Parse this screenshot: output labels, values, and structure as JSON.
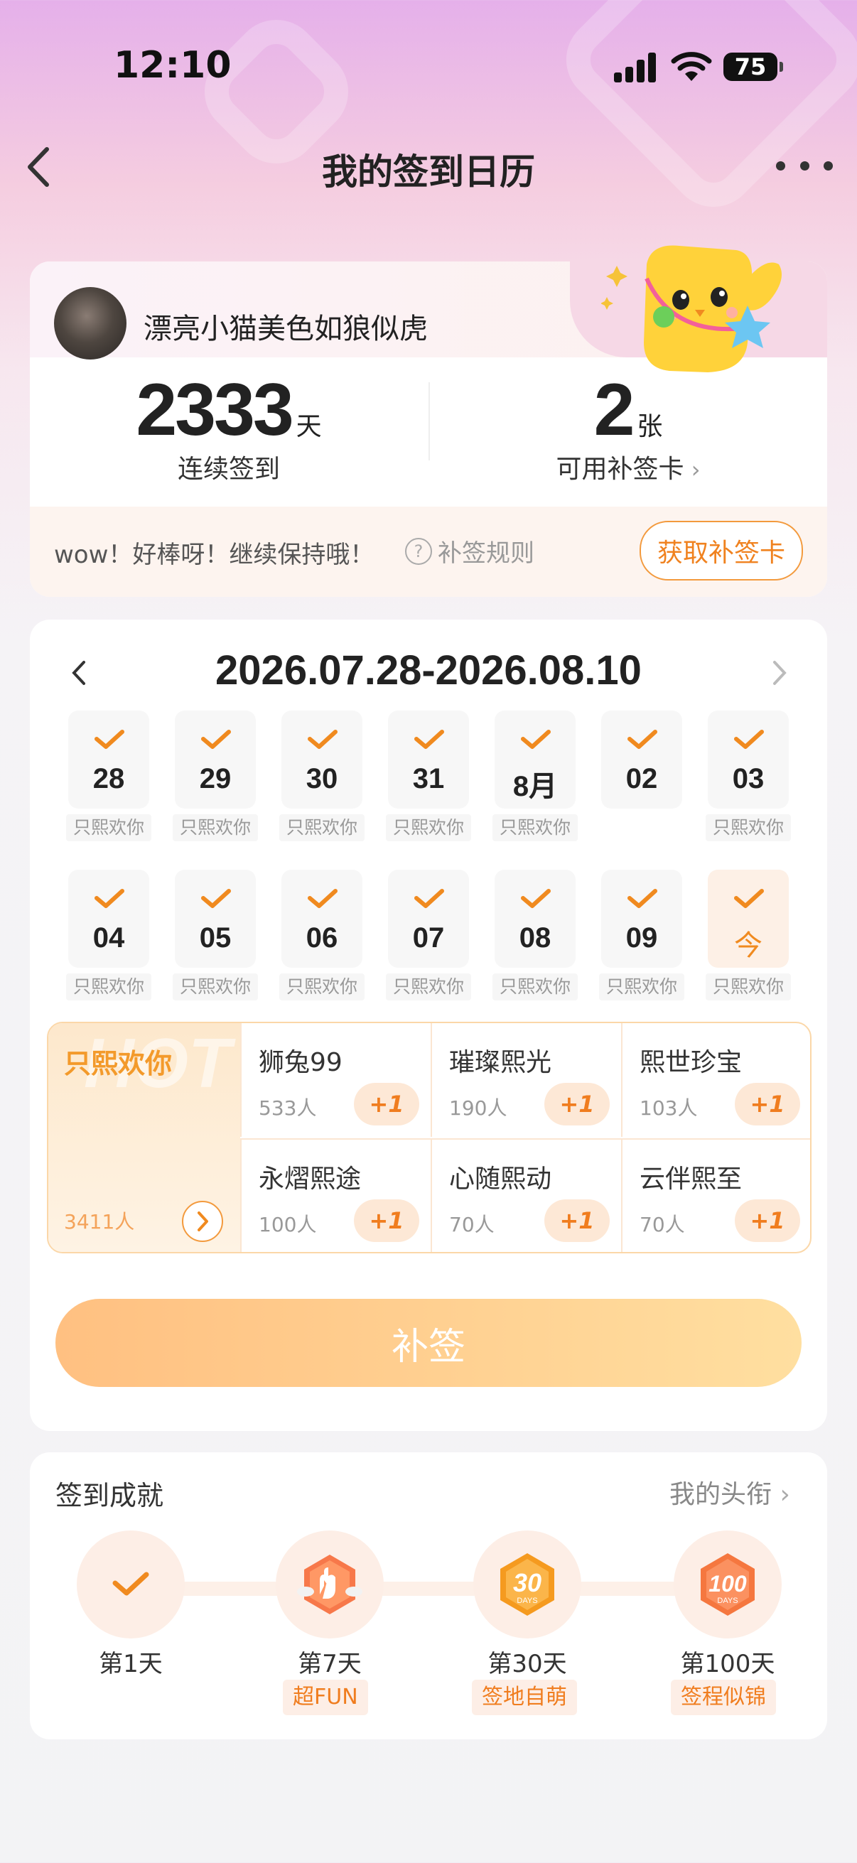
{
  "status_bar": {
    "time": "12:10",
    "battery": "75"
  },
  "nav": {
    "title": "我的签到日历"
  },
  "profile": {
    "username": "漂亮小猫美色如狼似虎",
    "streak_value": "2333",
    "streak_unit": "天",
    "streak_label": "连续签到",
    "cards_value": "2",
    "cards_unit": "张",
    "cards_label": "可用补签卡",
    "cheer_text": "wow！好棒呀！继续保持哦！",
    "rules_text": "补签规则",
    "get_card_btn": "获取补签卡"
  },
  "calendar": {
    "range": "2026.07.28-2026.08.10",
    "week1": [
      {
        "day": "28",
        "tag": "只熙欢你"
      },
      {
        "day": "29",
        "tag": "只熙欢你"
      },
      {
        "day": "30",
        "tag": "只熙欢你"
      },
      {
        "day": "31",
        "tag": "只熙欢你"
      },
      {
        "day": "8月",
        "tag": "只熙欢你"
      },
      {
        "day": "02",
        "tag": ""
      },
      {
        "day": "03",
        "tag": "只熙欢你"
      }
    ],
    "week2": [
      {
        "day": "04",
        "tag": "只熙欢你"
      },
      {
        "day": "05",
        "tag": "只熙欢你"
      },
      {
        "day": "06",
        "tag": "只熙欢你"
      },
      {
        "day": "07",
        "tag": "只熙欢你"
      },
      {
        "day": "08",
        "tag": "只熙欢你"
      },
      {
        "day": "09",
        "tag": "只熙欢你"
      },
      {
        "day": "今",
        "tag": "只熙欢你"
      }
    ]
  },
  "hot": {
    "bg_text": "HOT",
    "featured_name": "只熙欢你",
    "featured_count": "3411人",
    "options": [
      {
        "name": "狮兔99",
        "count": "533人",
        "plus": "+1"
      },
      {
        "name": "璀璨熙光",
        "count": "190人",
        "plus": "+1"
      },
      {
        "name": "熙世珍宝",
        "count": "103人",
        "plus": "+1"
      },
      {
        "name": "永熠熙途",
        "count": "100人",
        "plus": "+1"
      },
      {
        "name": "心随熙动",
        "count": "70人",
        "plus": "+1"
      },
      {
        "name": "云伴熙至",
        "count": "70人",
        "plus": "+1"
      }
    ]
  },
  "resign_btn": "补签",
  "achievements": {
    "title": "签到成就",
    "link": "我的头衔",
    "badges": [
      {
        "label": "第1天",
        "sub": ""
      },
      {
        "label": "第7天",
        "sub": "超FUN"
      },
      {
        "label": "第30天",
        "sub": "签地自萌"
      },
      {
        "label": "第100天",
        "sub": "签程似锦"
      }
    ],
    "accent": "#f08a1f"
  }
}
